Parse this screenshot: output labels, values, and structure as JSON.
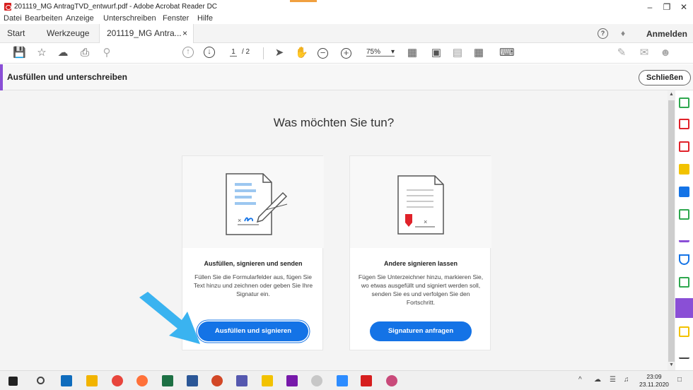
{
  "window": {
    "title": "201119_MG AntragTVD_entwurf.pdf - Adobe Acrobat Reader DC",
    "controls": [
      "–",
      "❐",
      "✕"
    ]
  },
  "menu": [
    "Datei",
    "Bearbeiten",
    "Anzeige",
    "Unterschreiben",
    "Fenster",
    "Hilfe"
  ],
  "tabs": {
    "start": "Start",
    "tools": "Werkzeuge",
    "document": "201119_MG Antra...",
    "close": "×",
    "signin": "Anmelden"
  },
  "toolbar": {
    "page_current": "1",
    "page_total": "/ 2",
    "zoom": "75%",
    "zoom_caret": "▾"
  },
  "toolpanel": {
    "name": "Ausfüllen und unterschreiben",
    "close_label": "Schließen",
    "accent": "#8a4fd6"
  },
  "main": {
    "heading": "Was möchten Sie tun?",
    "cards": [
      {
        "title": "Ausfüllen, signieren und senden",
        "description": "Füllen Sie die Formularfelder aus, fügen Sie Text hinzu und zeichnen oder geben Sie Ihre Signatur ein.",
        "button": "Ausfüllen und signieren"
      },
      {
        "title": "Andere signieren lassen",
        "description": "Fügen Sie Unterzeichner hinzu, markieren Sie, wo etwas ausgefüllt und signiert werden soll, senden Sie es und verfolgen Sie den Fortschritt.",
        "button": "Signaturen anfragen"
      }
    ],
    "button_color": "#1473e6",
    "arrow_color": "#3ab3f0"
  },
  "scroll": {
    "up": "▲",
    "down": "▼"
  },
  "taskbar": {
    "time": "23:09",
    "date": "23.11.2020",
    "tray_caret": "^"
  }
}
